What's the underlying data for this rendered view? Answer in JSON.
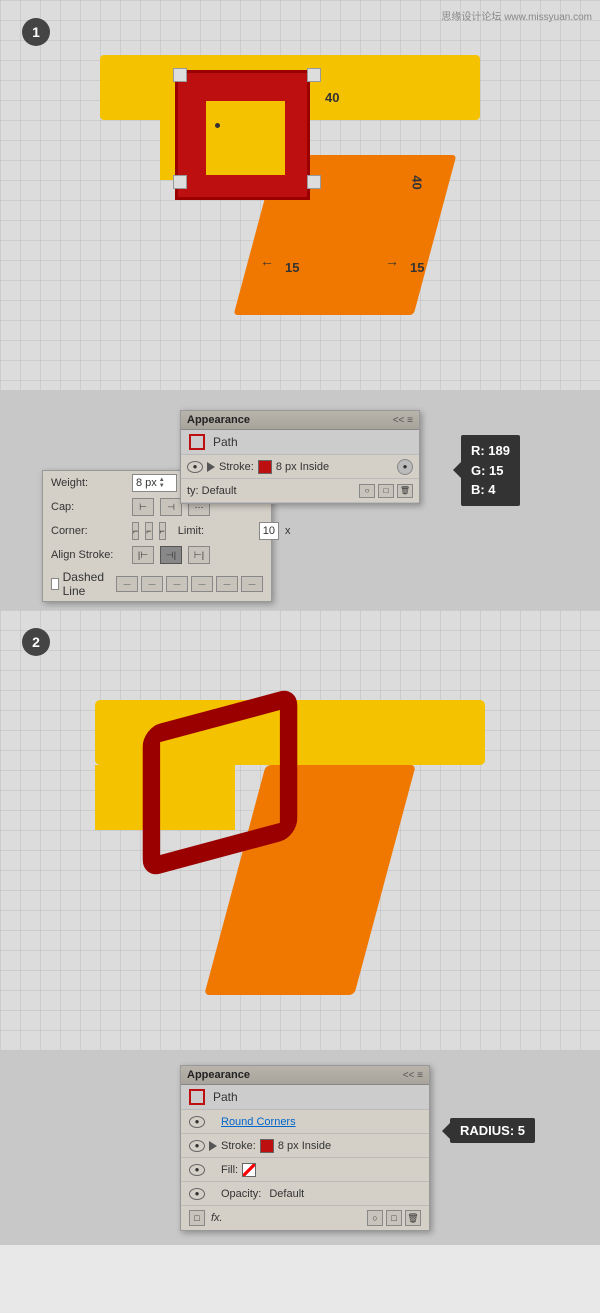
{
  "watermark": "思缘设计论坛  www.missyuan.com",
  "section1": {
    "step": "1",
    "measurements": {
      "top": "40",
      "side": "40",
      "left": "15",
      "right": "15"
    }
  },
  "panel1": {
    "title": "Appearance",
    "controls": "<<  ≡",
    "path_label": "Path",
    "rows": [
      {
        "eye": true,
        "play": true,
        "label": "Stroke:",
        "swatch": "red",
        "value": "8 px  Inside"
      },
      {
        "eye": false,
        "play": false,
        "label": "ty: Default",
        "value": ""
      }
    ],
    "bottom_icons": [
      "circle-icon",
      "square-icon",
      "trash-icon"
    ]
  },
  "stroke_panel": {
    "weight_label": "Weight:",
    "weight_value": "8 px",
    "cap_label": "Cap:",
    "corner_label": "Corner:",
    "limit_label": "Limit:",
    "limit_value": "10",
    "align_label": "Align Stroke:",
    "dashed_label": "Dashed Line"
  },
  "rgb_tooltip": {
    "r": "R: 189",
    "g": "G: 15",
    "b": "B: 4"
  },
  "section2": {
    "step": "2"
  },
  "panel2": {
    "title": "Appearance",
    "controls": "<<  ≡",
    "path_label": "Path",
    "rows": [
      {
        "eye": true,
        "play": false,
        "label": "Round Corners",
        "is_link": true
      },
      {
        "eye": true,
        "play": true,
        "label": "Stroke:",
        "swatch": "red",
        "value": "8 px  Inside"
      },
      {
        "eye": true,
        "play": false,
        "label": "Fill:",
        "swatch": "striped",
        "value": ""
      },
      {
        "eye": true,
        "play": false,
        "label": "Opacity:",
        "value": "Default"
      }
    ],
    "footer_icons": [
      "page-icon",
      "fx-label",
      "circle-icon",
      "square-icon",
      "trash-icon"
    ]
  },
  "radius_tooltip": {
    "label": "RADIUS: 5"
  }
}
